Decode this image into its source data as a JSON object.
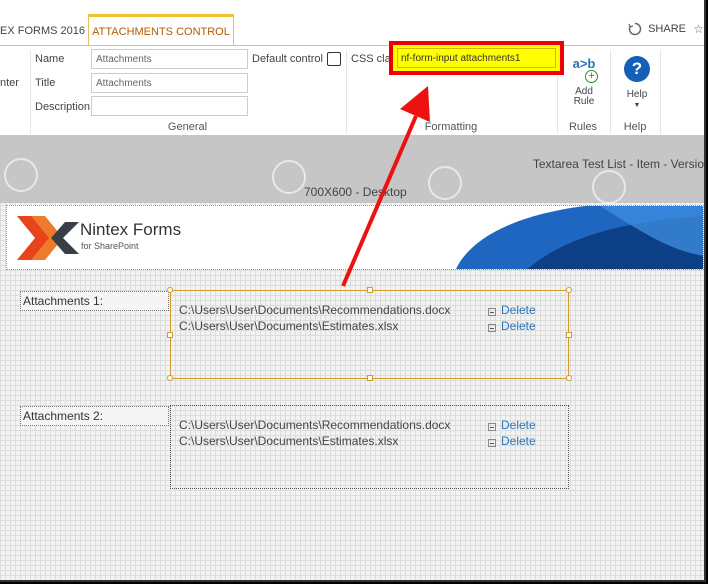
{
  "tabs": {
    "forms_tab": "EX FORMS 2016",
    "active_tab": "ATTACHMENTS CONTROL"
  },
  "share": {
    "label": "SHARE"
  },
  "ribbon": {
    "left_cut_label": "nter",
    "name_label": "Name",
    "name_value": "Attachments",
    "title_label": "Title",
    "title_value": "Attachments",
    "description_label": "Description",
    "description_value": "",
    "default_control_label": "Default control",
    "css_class_label": "CSS clas",
    "css_class_value": "nf-form-input attachments1",
    "add_rule_label": "Add Rule",
    "add_rule_icon_text": "a>b",
    "help_label": "Help",
    "group_general": "General",
    "group_formatting": "Formatting",
    "group_rules": "Rules",
    "group_help": "Help"
  },
  "canvas": {
    "list_title": "Textarea Test List - Item - Versio",
    "device_title": "700X600 - Desktop",
    "logo_brand": "Nintex Forms",
    "logo_sub": "for SharePoint",
    "attachments": [
      {
        "label": "Attachments 1:",
        "files": [
          {
            "path": "C:\\Users\\User\\Documents\\Recommendations.docx",
            "action": "Delete"
          },
          {
            "path": "C:\\Users\\User\\Documents\\Estimates.xlsx",
            "action": "Delete"
          }
        ]
      },
      {
        "label": "Attachments 2:",
        "files": [
          {
            "path": "C:\\Users\\User\\Documents\\Recommendations.docx",
            "action": "Delete"
          },
          {
            "path": "C:\\Users\\User\\Documents\\Estimates.xlsx",
            "action": "Delete"
          }
        ]
      }
    ]
  },
  "colors": {
    "tab_accent": "#f1c232",
    "highlight_border": "#ff0000",
    "highlight_fill": "#ffff00",
    "link": "#2a75b8",
    "selection": "#d19a2a"
  }
}
